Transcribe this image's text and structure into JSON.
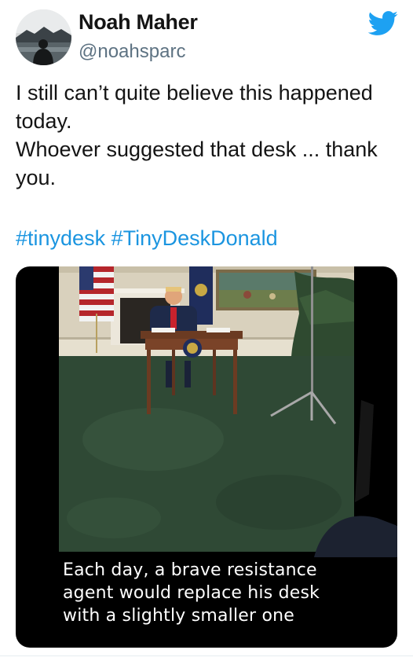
{
  "author": {
    "name": "Noah Maher",
    "handle": "@noahsparc"
  },
  "tweet": {
    "text_lines": [
      "I still can’t quite believe this happened",
      "today.",
      "Whoever suggested that desk ... thank",
      "you."
    ],
    "hashtags": [
      "#tinydesk",
      "#TinyDeskDonald"
    ]
  },
  "media": {
    "caption_lines": [
      "Each day, a brave resistance",
      "agent would replace his desk",
      "with a slightly smaller one"
    ]
  },
  "icons": {
    "platform": "twitter-bird-icon"
  },
  "colors": {
    "accent": "#1b95e0",
    "handle": "#5d7282",
    "text": "#141414",
    "media_bg": "#000000"
  }
}
